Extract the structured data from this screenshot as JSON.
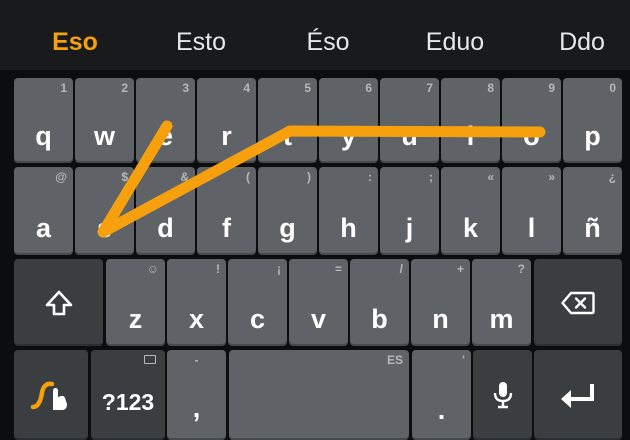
{
  "suggestions": [
    {
      "text": "Eso",
      "highlighted": true
    },
    {
      "text": "Esto",
      "highlighted": false
    },
    {
      "text": "Éso",
      "highlighted": false
    },
    {
      "text": "Eduo",
      "highlighted": false
    },
    {
      "text": "Ddo",
      "highlighted": false
    }
  ],
  "rows": {
    "row1": [
      {
        "label": "q",
        "hint": "1"
      },
      {
        "label": "w",
        "hint": "2"
      },
      {
        "label": "e",
        "hint": "3"
      },
      {
        "label": "r",
        "hint": "4"
      },
      {
        "label": "t",
        "hint": "5"
      },
      {
        "label": "y",
        "hint": "6"
      },
      {
        "label": "u",
        "hint": "7"
      },
      {
        "label": "i",
        "hint": "8"
      },
      {
        "label": "o",
        "hint": "9"
      },
      {
        "label": "p",
        "hint": "0"
      }
    ],
    "row2": [
      {
        "label": "a",
        "hint": "@"
      },
      {
        "label": "s",
        "hint": "$"
      },
      {
        "label": "d",
        "hint": "&"
      },
      {
        "label": "f",
        "hint": "("
      },
      {
        "label": "g",
        "hint": ")"
      },
      {
        "label": "h",
        "hint": ":"
      },
      {
        "label": "j",
        "hint": ";"
      },
      {
        "label": "k",
        "hint": "«"
      },
      {
        "label": "l",
        "hint": "»"
      },
      {
        "label": "ñ",
        "hint": "¿"
      }
    ],
    "row3": [
      {
        "label": "z",
        "hint": "☺"
      },
      {
        "label": "x",
        "hint": "!"
      },
      {
        "label": "c",
        "hint": "¡"
      },
      {
        "label": "v",
        "hint": "="
      },
      {
        "label": "b",
        "hint": "/"
      },
      {
        "label": "n",
        "hint": "+"
      },
      {
        "label": "m",
        "hint": "?"
      }
    ]
  },
  "bottom": {
    "symbols_label": "?123",
    "comma": ",",
    "comma_hint": "-",
    "space_lang": "ES",
    "period": ".",
    "period_hint": "'"
  },
  "icons": {
    "shift": "shift-arrow-icon",
    "delete": "backspace-icon",
    "swype": "swype-logo-icon",
    "mic": "microphone-icon",
    "enter": "enter-return-icon",
    "clipboard": "clipboard-icon"
  },
  "colors": {
    "accent": "#f5a00c",
    "key": "#5f6266",
    "key_dark": "#3b3e41",
    "background": "#0c0d0e",
    "suggestion_bar": "#181a1c"
  },
  "swipe_path_keys": [
    "o",
    "i",
    "u",
    "y",
    "t",
    "r",
    "e",
    "w",
    "s",
    "a",
    "s"
  ]
}
